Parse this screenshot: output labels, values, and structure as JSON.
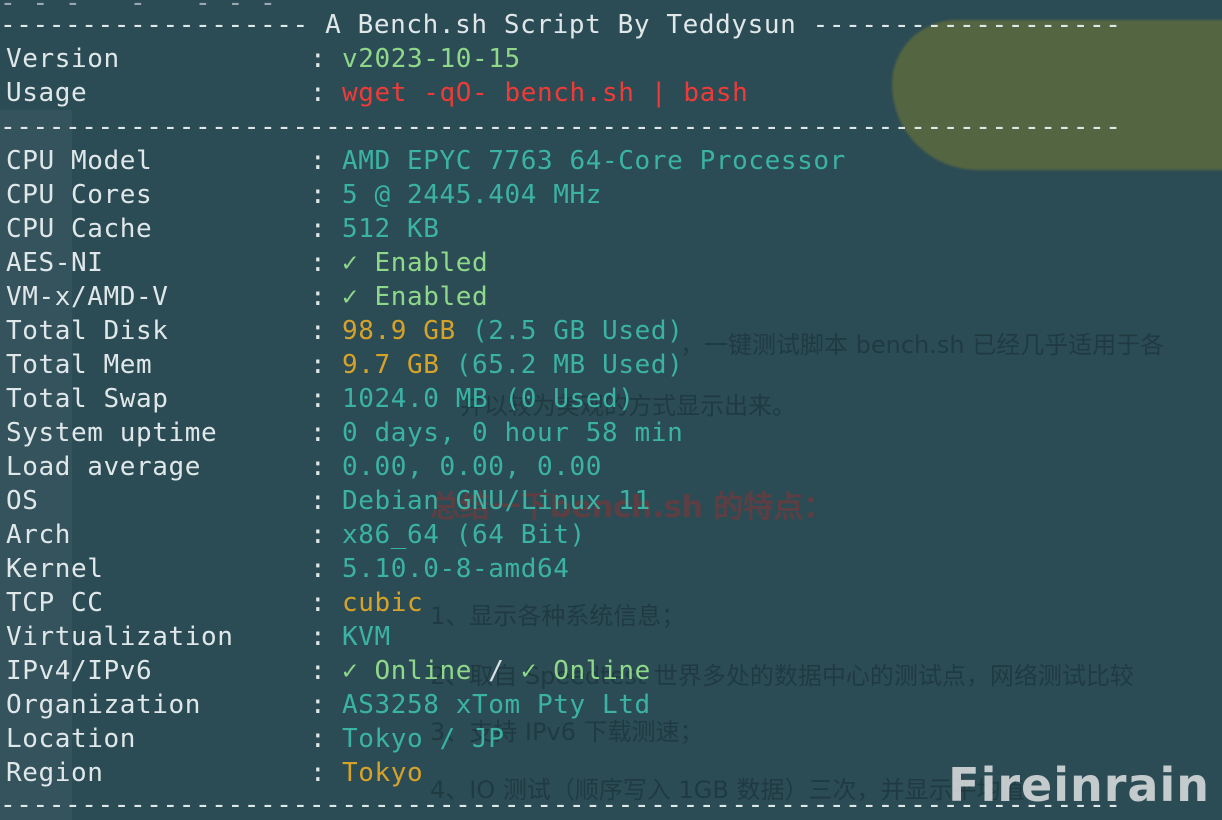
{
  "header": {
    "title_line": "------------------- A Bench.sh Script By Teddysun -------------------",
    "top_fragment": "- - -   -   - - -"
  },
  "meta": [
    {
      "label": "Version",
      "value": "v2023-10-15",
      "color": "#8fd88a"
    },
    {
      "label": "Usage",
      "value": "wget -qO- bench.sh | bash",
      "color": "#ef3b37"
    }
  ],
  "separator": "---------------------------------------------------------------------",
  "rows": [
    {
      "label": "CPU Model",
      "value": "AMD EPYC 7763 64-Core Processor",
      "color": "#3bb3a4"
    },
    {
      "label": "CPU Cores",
      "value": "5 @ 2445.404 MHz",
      "color": "#3bb3a4"
    },
    {
      "label": "CPU Cache",
      "value": "512 KB",
      "color": "#3bb3a4"
    },
    {
      "label": "AES-NI",
      "value": "✓ Enabled",
      "color": "#8fd88a"
    },
    {
      "label": "VM-x/AMD-V",
      "value": "✓ Enabled",
      "color": "#8fd88a"
    },
    {
      "label": "Total Disk",
      "value": "98.9 GB",
      "extra": " (2.5 GB Used)",
      "color": "#d6a22a",
      "extra_color": "#3bb3a4"
    },
    {
      "label": "Total Mem",
      "value": "9.7 GB",
      "extra": " (65.2 MB Used)",
      "color": "#d6a22a",
      "extra_color": "#3bb3a4"
    },
    {
      "label": "Total Swap",
      "value": "1024.0 MB (0 Used)",
      "color": "#3bb3a4"
    },
    {
      "label": "System uptime",
      "value": "0 days, 0 hour 58 min",
      "color": "#3bb3a4"
    },
    {
      "label": "Load average",
      "value": "0.00, 0.00, 0.00",
      "color": "#3bb3a4"
    },
    {
      "label": "OS",
      "value": "Debian GNU/Linux 11",
      "color": "#3bb3a4"
    },
    {
      "label": "Arch",
      "value": "x86_64 (64 Bit)",
      "color": "#3bb3a4"
    },
    {
      "label": "Kernel",
      "value": "5.10.0-8-amd64",
      "color": "#3bb3a4"
    },
    {
      "label": "TCP CC",
      "value": "cubic",
      "color": "#d6a22a"
    },
    {
      "label": "Virtualization",
      "value": "KVM",
      "color": "#3bb3a4"
    },
    {
      "label": "IPv4/IPv6",
      "value": "✓ Online",
      "mid": " / ",
      "extra": "✓ Online",
      "color": "#8fd88a",
      "mid_color": "#d9e1e3",
      "extra_color": "#8fd88a"
    },
    {
      "label": "Organization",
      "value": "AS3258 xTom Pty Ltd",
      "color": "#3bb3a4"
    },
    {
      "label": "Location",
      "value": "Tokyo / JP",
      "color": "#3bb3a4"
    },
    {
      "label": "Region",
      "value": "Tokyo",
      "color": "#d6a22a"
    }
  ],
  "colon": ":",
  "watermark": "Fireinrain",
  "background_text": [
    "，一键测试脚本 bench.sh 已经几乎适用于各",
    "并以较为美观的方式显示出来。",
    "总结一下bench.sh 的特点：",
    "1、显示各种系统信息；",
    "2、取自 Speedtest 世界多处的数据中心的测试点，网络测试比较",
    "3、支持 IPv6 下载测速；",
    "4、IO 测试（顺序写入 1GB 数据）三次，并显示平均值"
  ]
}
